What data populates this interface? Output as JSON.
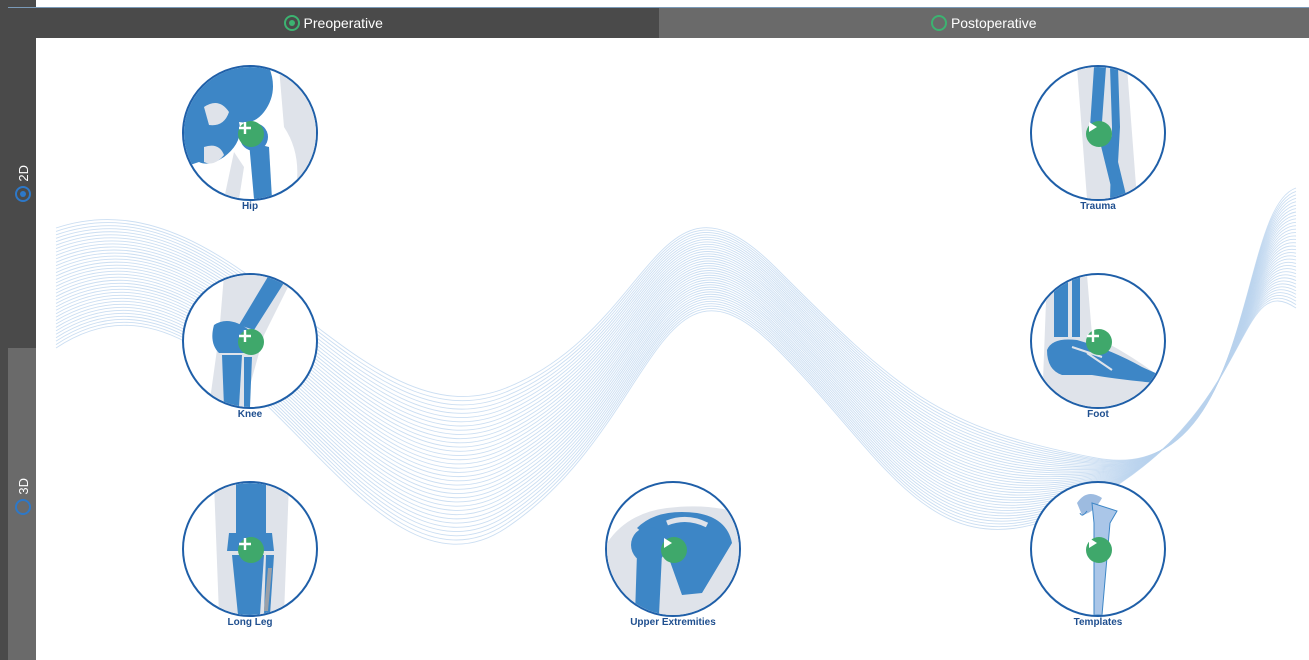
{
  "tabs": {
    "top": [
      {
        "label": "Preoperative",
        "selected": true
      },
      {
        "label": "Postoperative",
        "selected": false
      }
    ],
    "side": [
      {
        "label": "2D",
        "selected": true
      },
      {
        "label": "3D",
        "selected": false
      }
    ]
  },
  "tiles": [
    {
      "label": "Hip",
      "action": "add"
    },
    {
      "label": "Knee",
      "action": "add"
    },
    {
      "label": "Long Leg",
      "action": "add"
    },
    {
      "label": "Upper Extremities",
      "action": "play"
    },
    {
      "label": "Trauma",
      "action": "play"
    },
    {
      "label": "Foot",
      "action": "add"
    },
    {
      "label": "Templates",
      "action": "play"
    }
  ],
  "colors": {
    "accent_green": "#3fa86b",
    "bone_blue": "#3d86c6",
    "ring_blue": "#1f5fa8",
    "radio_blue": "#2d78c8",
    "wave": "#b9d3ee"
  },
  "icons": {
    "add": "plus-icon",
    "play": "play-icon"
  }
}
